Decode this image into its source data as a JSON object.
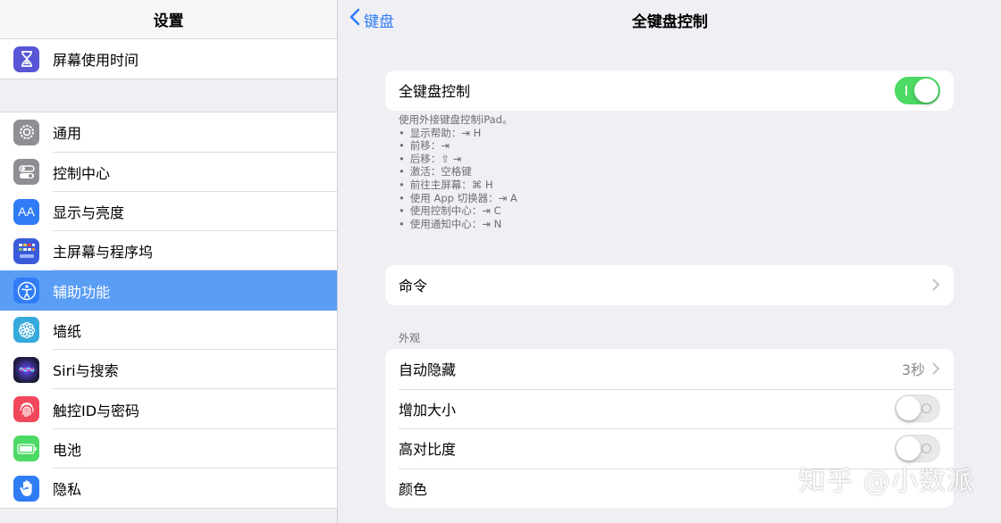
{
  "sidebar": {
    "title": "设置",
    "top_item": {
      "label": "屏幕使用时间",
      "icon": "hourglass-icon",
      "color": "#5856d6"
    },
    "items": [
      {
        "label": "通用",
        "icon": "gear-icon",
        "color": "#8e8e93"
      },
      {
        "label": "控制中心",
        "icon": "toggles-icon",
        "color": "#8e8e93"
      },
      {
        "label": "显示与亮度",
        "icon": "text-size-icon",
        "color": "#2f7cf6"
      },
      {
        "label": "主屏幕与程序坞",
        "icon": "app-grid-icon",
        "color": "#3a5bd9"
      },
      {
        "label": "辅助功能",
        "icon": "accessibility-icon",
        "color": "#2f7cf6",
        "active": true
      },
      {
        "label": "墙纸",
        "icon": "flower-icon",
        "color": "#36aadc"
      },
      {
        "label": "Siri与搜索",
        "icon": "siri-icon",
        "color": "#222244"
      },
      {
        "label": "触控ID与密码",
        "icon": "fingerprint-icon",
        "color": "#f0475b"
      },
      {
        "label": "电池",
        "icon": "battery-icon",
        "color": "#4cd964"
      },
      {
        "label": "隐私",
        "icon": "hand-icon",
        "color": "#2f7cf6"
      }
    ]
  },
  "nav": {
    "back_label": "键盘",
    "title": "全键盘控制"
  },
  "main": {
    "fkc_row": {
      "label": "全键盘控制",
      "toggle_on": true
    },
    "description": {
      "intro": "使用外接键盘控制iPad。",
      "bullets": [
        "显示帮助：⇥ H",
        "前移：⇥",
        "后移：⇧ ⇥",
        "激活：空格键",
        "前往主屏幕：⌘ H",
        "使用 App 切换器：⇥ A",
        "使用控制中心：⇥ C",
        "使用通知中心：⇥ N"
      ]
    },
    "commands_row": {
      "label": "命令"
    },
    "appearance": {
      "header": "外观",
      "auto_hide": {
        "label": "自动隐藏",
        "value": "3秒"
      },
      "increase_size": {
        "label": "增加大小",
        "toggle_on": false
      },
      "high_contrast": {
        "label": "高对比度",
        "toggle_on": false
      },
      "color": {
        "label": "颜色"
      }
    }
  },
  "watermark": "知乎 @小数派",
  "colors": {
    "accent": "#2f7cf6",
    "selection": "#5a9df5",
    "toggle_on": "#4cd964"
  }
}
